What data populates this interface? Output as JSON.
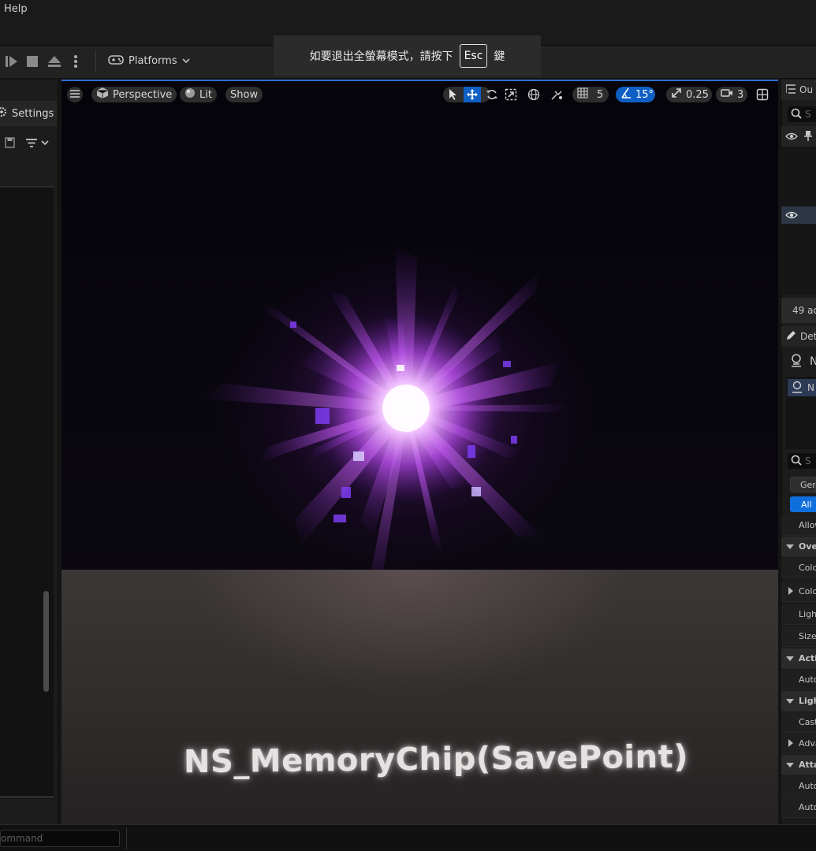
{
  "menu": {
    "help_label": "Help"
  },
  "toolbar": {
    "platforms_label": "Platforms"
  },
  "toast": {
    "text_before": "如要退出全螢幕模式，請按下",
    "key_label": "Esc",
    "text_after": "鍵"
  },
  "left_panel": {
    "settings_label": "Settings"
  },
  "viewport": {
    "perspective_label": "Perspective",
    "lit_label": "Lit",
    "show_label": "Show",
    "grid_snap_value": "5",
    "rotation_snap_value": "15°",
    "scale_snap_value": "0.25",
    "camera_speed_value": "3",
    "scene_label": "NS_MemoryChip(SavePoint)"
  },
  "right_panel": {
    "outliner_tab": "Ou",
    "search_placeholder": "S",
    "actor_count": "49 ac",
    "details_tab": "Det",
    "selected_name": "N",
    "component_name": "N",
    "details_search_placeholder": "S",
    "filter_general": "Gen",
    "filter_all": "All",
    "rows": [
      {
        "kind": "sub",
        "label": "Allow"
      },
      {
        "kind": "cat",
        "label": "Ove"
      },
      {
        "kind": "sub",
        "label": "Colo"
      },
      {
        "kind": "sub",
        "label": "Colo"
      },
      {
        "kind": "sub",
        "label": "Ligh"
      },
      {
        "kind": "sub",
        "label": "Size"
      },
      {
        "kind": "cat",
        "label": "Acti"
      },
      {
        "kind": "sub",
        "label": "Auto"
      },
      {
        "kind": "cat",
        "label": "Ligh"
      },
      {
        "kind": "sub",
        "label": "Cast"
      },
      {
        "kind": "sub",
        "label": "Adva"
      },
      {
        "kind": "cat",
        "label": "Atta"
      },
      {
        "kind": "sub",
        "label": "Auto"
      },
      {
        "kind": "sub",
        "label": "Auto"
      }
    ]
  },
  "statusbar": {
    "command_placeholder": "ommand"
  },
  "colors": {
    "accent_blue": "#0f5fc4",
    "panel_bg": "#1c1c1c",
    "viewport_border": "#2f6fd0"
  },
  "icons": [
    "menu-icon",
    "cube-icon",
    "sphere-icon",
    "select-arrow-icon",
    "move-icon",
    "rotate-icon",
    "scale-icon",
    "globe-icon",
    "surface-snap-icon",
    "grid-icon",
    "angle-icon",
    "scale-snap-icon",
    "camera-icon",
    "layout-icon",
    "play-icon",
    "stop-icon",
    "eject-icon",
    "more-icon",
    "gamepad-icon",
    "gear-icon",
    "save-icon",
    "filter-icon",
    "eye-icon",
    "pin-icon",
    "search-icon",
    "pencil-icon",
    "actor-icon"
  ]
}
